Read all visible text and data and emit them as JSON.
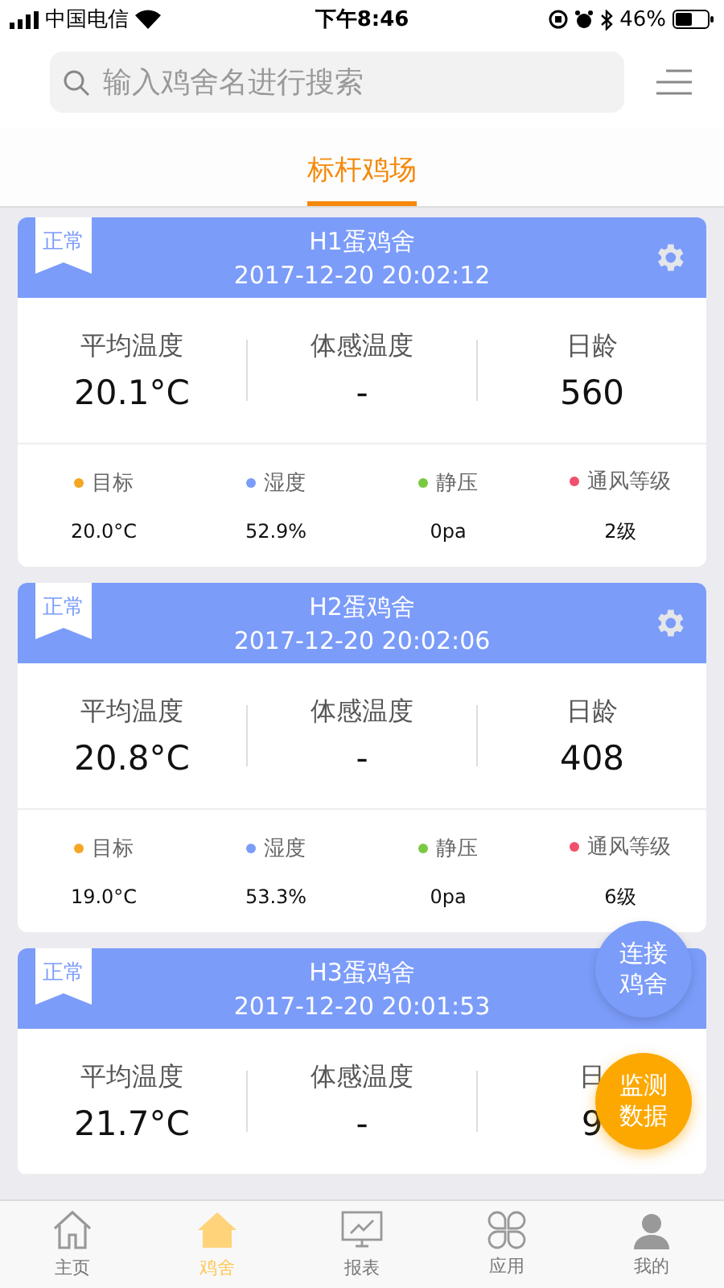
{
  "status_bar": {
    "carrier": "中国电信",
    "time": "下午8:46",
    "battery": "46%"
  },
  "search": {
    "placeholder": "输入鸡舍名进行搜索"
  },
  "tabs": [
    {
      "label": "标杆鸡场",
      "selected": true
    }
  ],
  "houses": [
    {
      "badge": "正常",
      "settings": true,
      "name": "H1蛋鸡舍",
      "time": "2017-12-20 20:02:12",
      "metrics": [
        {
          "label": "平均温度",
          "value": "20.1°C"
        },
        {
          "label": "体感温度",
          "value": "-"
        },
        {
          "label": "日龄",
          "value": "560"
        }
      ],
      "stats": [
        {
          "label": "目标",
          "value": "20.0°C",
          "color": "#f5a623"
        },
        {
          "label": "湿度",
          "value": "52.9%",
          "color": "#7b9cf9"
        },
        {
          "label": "静压",
          "value": "0pa",
          "color": "#7ac943"
        },
        {
          "label": "通风等级",
          "value": "2级",
          "color": "#f0506e"
        }
      ]
    },
    {
      "badge": "正常",
      "settings": true,
      "name": "H2蛋鸡舍",
      "time": "2017-12-20 20:02:06",
      "metrics": [
        {
          "label": "平均温度",
          "value": "20.8°C"
        },
        {
          "label": "体感温度",
          "value": "-"
        },
        {
          "label": "日龄",
          "value": "408"
        }
      ],
      "stats": [
        {
          "label": "目标",
          "value": "19.0°C",
          "color": "#f5a623"
        },
        {
          "label": "湿度",
          "value": "53.3%",
          "color": "#7b9cf9"
        },
        {
          "label": "静压",
          "value": "0pa",
          "color": "#7ac943"
        },
        {
          "label": "通风等级",
          "value": "6级",
          "color": "#f0506e"
        }
      ]
    },
    {
      "badge": "正常",
      "name": "H3蛋鸡舍",
      "time": "2017-12-20 20:01:53",
      "metrics": [
        {
          "label": "平均温度",
          "value": "21.7°C"
        },
        {
          "label": "体感温度",
          "value": "-"
        },
        {
          "label": "日",
          "value": "9"
        }
      ]
    }
  ],
  "fab": [
    {
      "label": "连接鸡舍",
      "kind": "connect"
    },
    {
      "label": "监测数据",
      "kind": "monitor"
    }
  ],
  "nav": [
    {
      "label": "主页",
      "kind": "home",
      "selected": false
    },
    {
      "label": "鸡舍",
      "kind": "house",
      "selected": true
    },
    {
      "label": "报表",
      "kind": "report",
      "selected": false
    },
    {
      "label": "应用",
      "kind": "apps",
      "selected": false
    },
    {
      "label": "我的",
      "kind": "me",
      "selected": false
    }
  ]
}
